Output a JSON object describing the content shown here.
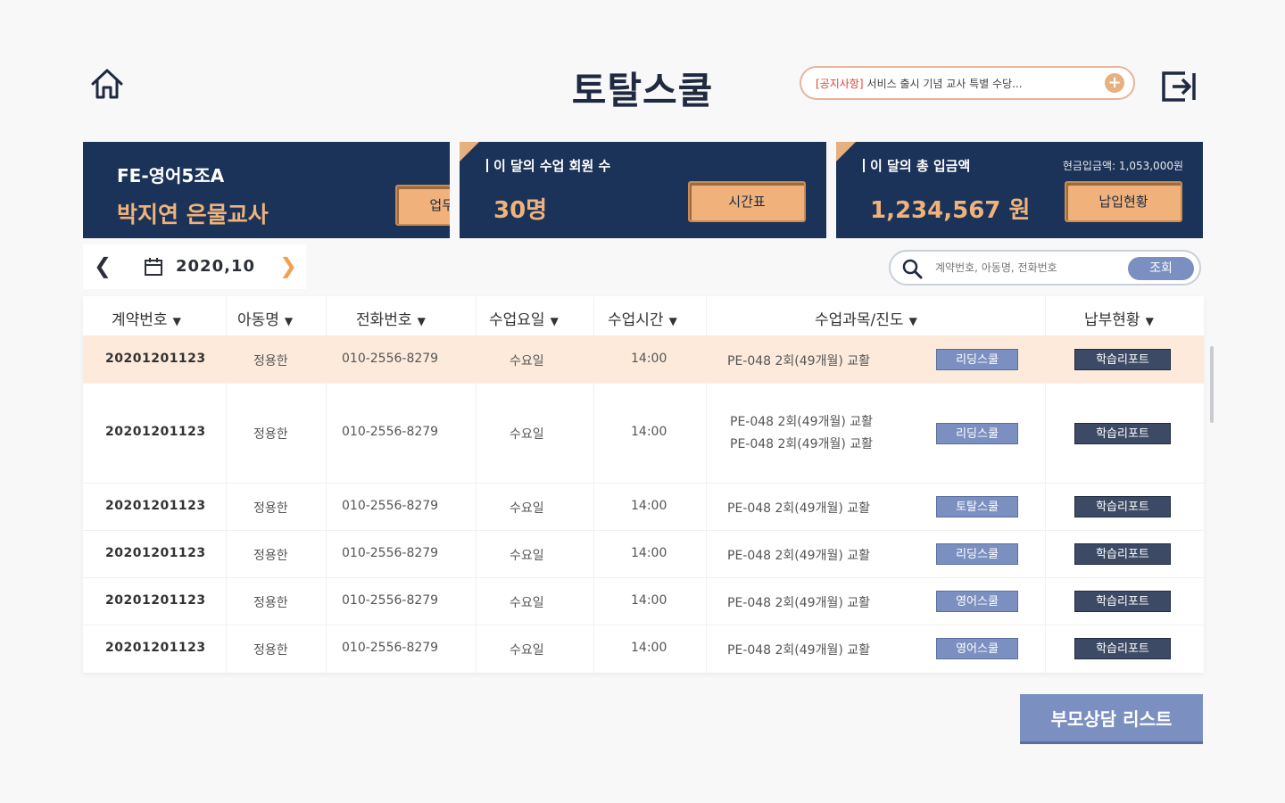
{
  "app": {
    "title": "토탈스쿨"
  },
  "notice": {
    "tag": "[공지사항]",
    "text": "서비스 출시 기념 교사 특별 수당..."
  },
  "cards": {
    "teacher": {
      "course": "FE-영어5조A",
      "name": "박지연 은물교사",
      "button": "업무관리"
    },
    "members": {
      "label": "이 달의 수업 회원 수",
      "value": "30명",
      "button": "시간표"
    },
    "income": {
      "label": "이 달의 총 입금액",
      "value": "1,234,567 원",
      "sub": "현금입금액: 1,053,000원",
      "button": "납입현황"
    }
  },
  "datebar": {
    "date": "2020,10"
  },
  "search": {
    "placeholder": "계약번호, 아동명, 전화번호",
    "button": "조회"
  },
  "table": {
    "headers": [
      "계약번호",
      "아동명",
      "전화번호",
      "수업요일",
      "수업시간",
      "수업과목/진도",
      "납부현황"
    ],
    "rows": [
      {
        "contract": "20201201123",
        "child": "정용한",
        "phone": "010-2556-8279",
        "day": "수요일",
        "time": "14:00",
        "subject": "PE-048 2회(49개월) 교활",
        "subject2": "",
        "tag": "리딩스쿨",
        "report": "학습리포트"
      },
      {
        "contract": "20201201123",
        "child": "정용한",
        "phone": "010-2556-8279",
        "day": "수요일",
        "time": "14:00",
        "subject": "PE-048 2회(49개월) 교활",
        "subject2": "PE-048 2회(49개월) 교활",
        "tag": "리딩스쿨",
        "report": "학습리포트"
      },
      {
        "contract": "20201201123",
        "child": "정용한",
        "phone": "010-2556-8279",
        "day": "수요일",
        "time": "14:00",
        "subject": "PE-048 2회(49개월) 교활",
        "subject2": "",
        "tag": "토탈스쿨",
        "report": "학습리포트"
      },
      {
        "contract": "20201201123",
        "child": "정용한",
        "phone": "010-2556-8279",
        "day": "수요일",
        "time": "14:00",
        "subject": "PE-048 2회(49개월) 교활",
        "subject2": "",
        "tag": "리딩스쿨",
        "report": "학습리포트"
      },
      {
        "contract": "20201201123",
        "child": "정용한",
        "phone": "010-2556-8279",
        "day": "수요일",
        "time": "14:00",
        "subject": "PE-048 2회(49개월) 교활",
        "subject2": "",
        "tag": "영어스쿨",
        "report": "학습리포트"
      },
      {
        "contract": "20201201123",
        "child": "정용한",
        "phone": "010-2556-8279",
        "day": "수요일",
        "time": "14:00",
        "subject": "PE-048 2회(49개월) 교활",
        "subject2": "",
        "tag": "영어스쿨",
        "report": "학습리포트"
      }
    ]
  },
  "footer": {
    "parent_button": "부모상담 리스트"
  },
  "colors": {
    "navy": "#1b3358",
    "accent": "#f0b27a",
    "pill": "#7b8fc0",
    "report": "#3d4a66",
    "selected_row": "#fdeadb"
  },
  "icons": {
    "home": "home-icon",
    "logout": "logout-icon",
    "calendar": "calendar-icon",
    "search": "search-icon",
    "plus": "plus-icon"
  }
}
